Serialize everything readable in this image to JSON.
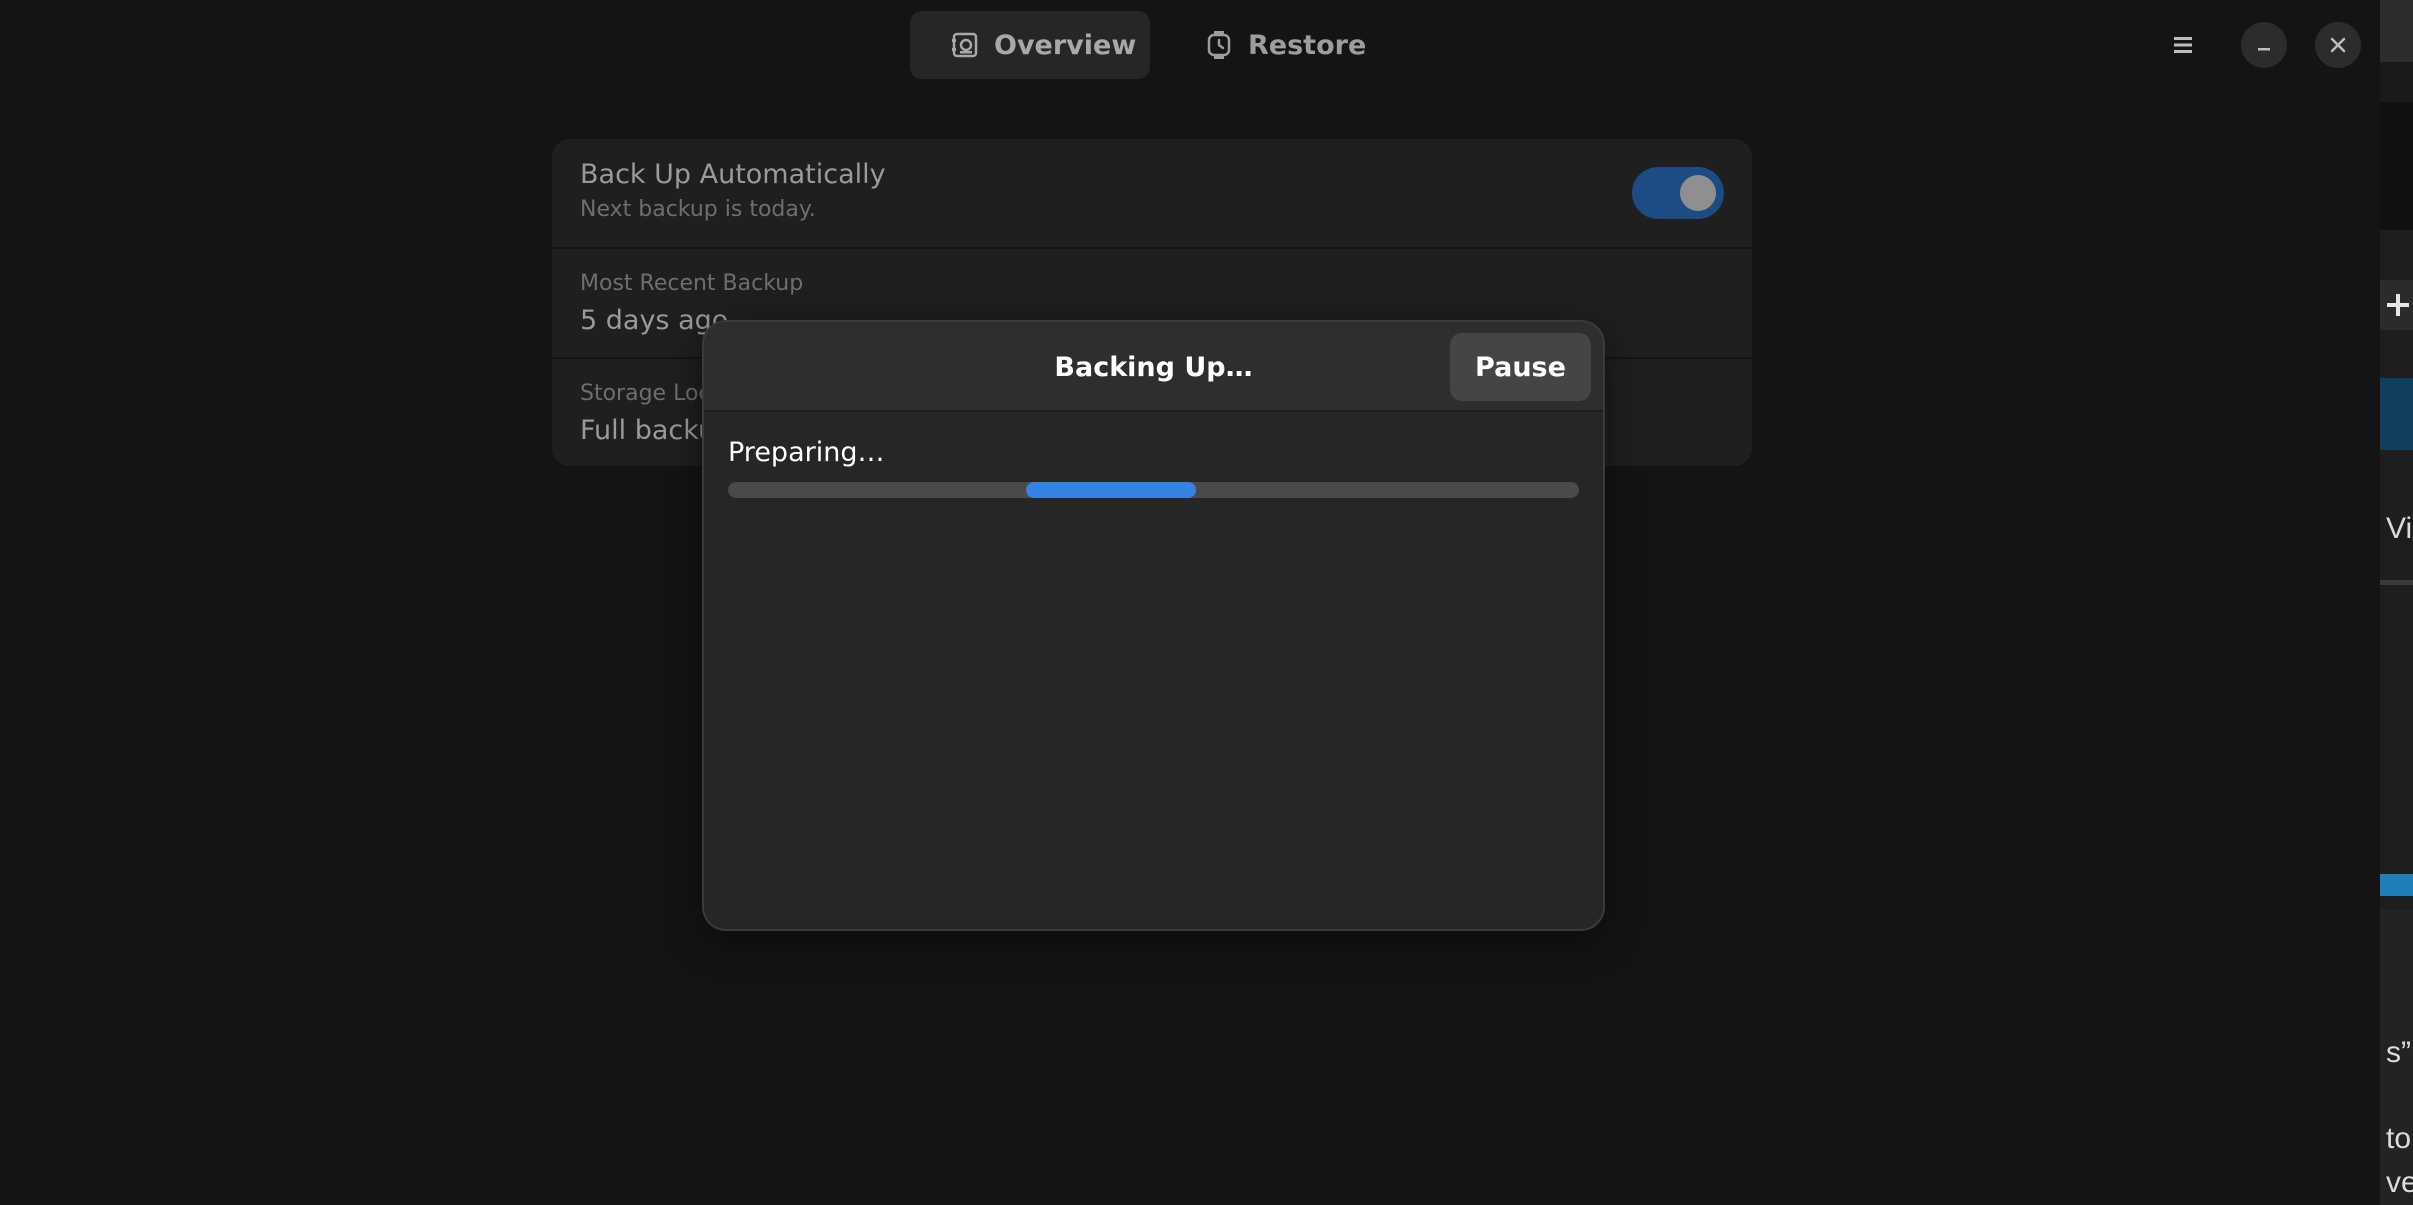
{
  "header": {
    "tabs": [
      {
        "label": "Overview",
        "icon": "overview-icon",
        "active": true
      },
      {
        "label": "Restore",
        "icon": "restore-clock-icon",
        "active": false
      }
    ],
    "icons": {
      "menu": "hamburger-menu-icon",
      "minimize": "minimize-icon",
      "close": "close-icon"
    }
  },
  "prefs": {
    "auto_backup": {
      "title": "Back Up Automatically",
      "subtitle": "Next backup is today.",
      "enabled": true
    },
    "recent": {
      "caption": "Most Recent Backup",
      "value": "5 days ago"
    },
    "storage": {
      "caption_visible": "Storage Loca",
      "value_visible": "Full backu"
    }
  },
  "dialog": {
    "title": "Backing Up…",
    "pause_label": "Pause",
    "status": "Preparing…",
    "progress": {
      "indeterminate": true,
      "pulse_start": 0.35,
      "pulse_end": 0.55
    }
  },
  "background_window": {
    "visible_texts": [
      "Vi",
      "s”",
      "to",
      "ve"
    ],
    "plus_icon": "plus-icon"
  },
  "colors": {
    "accent": "#3584e4",
    "toggle_on": "#1d4c84",
    "dialog_bg": "#262626",
    "window_bg": "#141414"
  }
}
